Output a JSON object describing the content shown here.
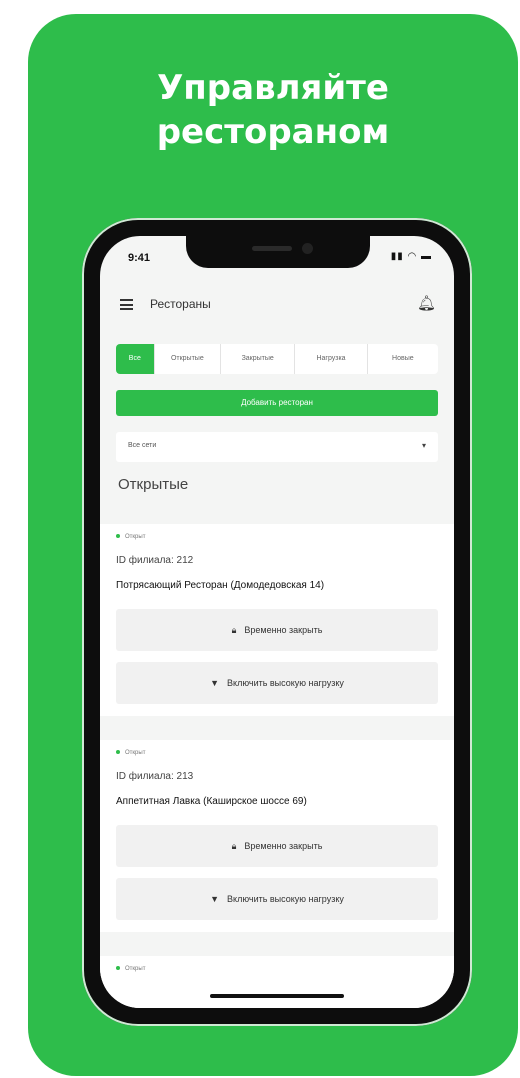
{
  "promo": {
    "headline_line1": "Управляйте",
    "headline_line2": "рестораном"
  },
  "status_bar": {
    "time": "9:41",
    "icons": "▮▮ ◠ ▬"
  },
  "header": {
    "title": "Рестораны",
    "menu_icon": "menu-icon",
    "bell_icon": "bell-icon"
  },
  "tabs": [
    {
      "label": "Все",
      "active": true
    },
    {
      "label": "Открытые",
      "active": false
    },
    {
      "label": "Закрытые",
      "active": false
    },
    {
      "label": "Нагрузка",
      "active": false
    },
    {
      "label": "Новые",
      "active": false
    }
  ],
  "add_button": {
    "label": "Добавить ресторан"
  },
  "network_select": {
    "value": "Все сети",
    "arrow": "▾"
  },
  "section": {
    "title": "Открытые"
  },
  "restaurants": [
    {
      "status": "Открыт",
      "branch_id": "ID филиала: 212",
      "name": "Потрясающий Ресторан (Домодедовская 14)",
      "close_label": "Временно закрыть",
      "load_label": "Включить высокую нагрузку"
    },
    {
      "status": "Открыт",
      "branch_id": "ID филиала: 213",
      "name": "Аппетитная Лавка (Каширское шоссе 69)",
      "close_label": "Временно закрыть",
      "load_label": "Включить высокую нагрузку"
    },
    {
      "status": "Открыт"
    }
  ],
  "colors": {
    "accent": "#2ebd4b",
    "phone_frame": "#0d0d0d",
    "screen_bg": "#f4f5f4"
  }
}
